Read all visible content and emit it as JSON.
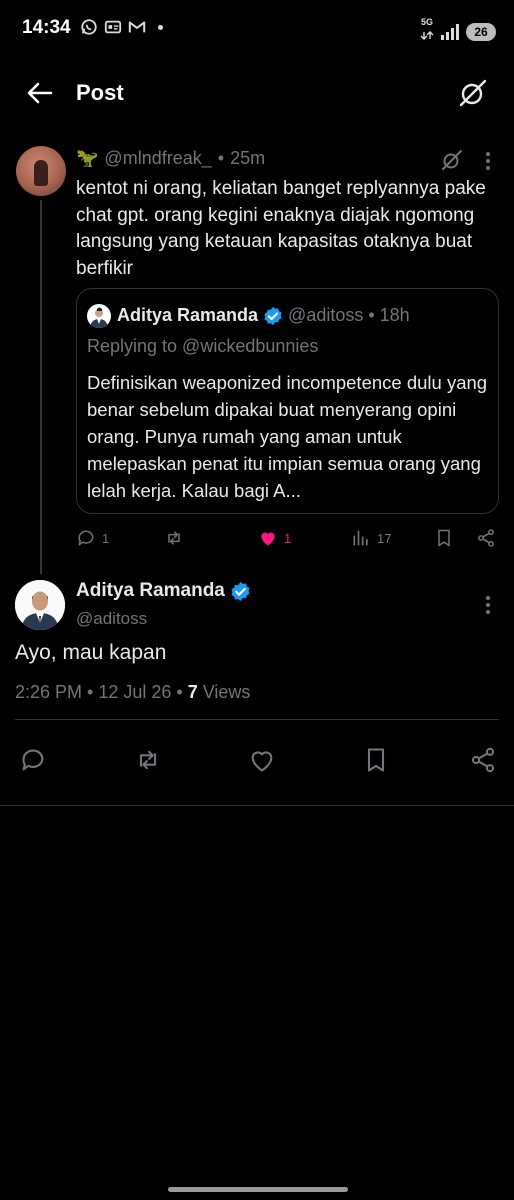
{
  "status_bar": {
    "time": "14:34",
    "network": "5G",
    "battery": "26"
  },
  "header": {
    "title": "Post"
  },
  "parent_tweet": {
    "handle": "@mlndfreak_",
    "separator": "•",
    "time": "25m",
    "text": "kentot ni orang, keliatan banget replyannya pake chat gpt. orang kegini enaknya diajak ngomong langsung yang ketauan kapasitas otaknya buat berfikir",
    "quote": {
      "name": "Aditya Ramanda",
      "handle": "@aditoss",
      "time": "• 18h",
      "replying_to": "Replying to @wickedbunnies",
      "text": "Definisikan weaponized incompetence dulu yang benar sebelum dipakai buat menyerang opini orang. Punya rumah yang aman untuk melepaskan penat itu impian semua orang yang lelah kerja. Kalau bagi A..."
    },
    "actions": {
      "replies": "1",
      "likes": "1",
      "views": "17",
      "like_color": "#f91880"
    }
  },
  "main_tweet": {
    "name": "Aditya Ramanda",
    "handle": "@aditoss",
    "text": "Ayo, mau kapan",
    "timestamp": "2:26 PM • 12 Jul 26 • ",
    "views_count": "7",
    "views_label": " Views"
  },
  "colors": {
    "verified": "#1d9bf0",
    "muted": "#71767b",
    "text": "#e7e9ea",
    "border": "#2f3336"
  }
}
